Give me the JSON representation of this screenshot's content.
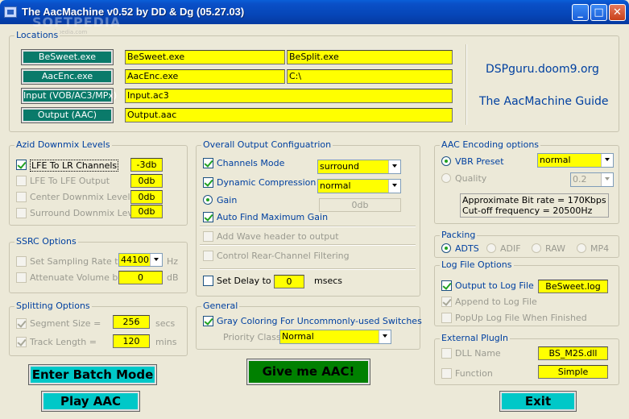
{
  "window": {
    "title": "The AacMachine v0.52 by DD & Dg (05.27.03)",
    "watermark": "SOFTPEDIA",
    "watermark_url": "www.softpedia.com"
  },
  "locations": {
    "label": "Locations",
    "besweet_btn": "BeSweet.exe",
    "aacenc_btn": "AacEnc.exe",
    "input_btn": "Input (VOB/AC3/MPx)",
    "output_btn": "Output (AAC)",
    "besweet_value": "BeSweet.exe",
    "besplit_value": "BeSplit.exe",
    "aacenc_value": "AacEnc.exe",
    "aacenc_path": "C:\\",
    "input_value": "Input.ac3",
    "output_value": "Output.aac",
    "site_link": "DSPguru.doom9.org",
    "guide_link": "The AacMachine Guide"
  },
  "downmix": {
    "label": "Azid Downmix Levels",
    "lfe_lr": "LFE To LR Channels",
    "lfe_lr_value": "-3db",
    "lfe_out": "LFE To LFE Output",
    "lfe_out_value": "0db",
    "center": "Center Downmix Level",
    "center_value": "0db",
    "surround": "Surround Downmix Level",
    "surround_value": "0db"
  },
  "ssrc": {
    "label": "SSRC Options",
    "rate_label": "Set Sampling Rate to",
    "rate_value": "44100",
    "rate_unit": "Hz",
    "atten_label": "Attenuate Volume by",
    "atten_value": "0",
    "atten_unit": "dB"
  },
  "splitting": {
    "label": "Splitting Options",
    "seg_label": "Segment Size =",
    "seg_value": "256",
    "seg_unit": "secs",
    "track_label": "Track Length  =",
    "track_value": "120",
    "track_unit": "mins"
  },
  "overall": {
    "label": "Overall Output Configuatrion",
    "channels_mode": "Channels Mode",
    "channels_value": "surround",
    "dyn_comp": "Dynamic Compression",
    "dyn_value": "normal",
    "gain": "Gain",
    "gain_value": "0db",
    "auto_find": "Auto Find Maximum Gain",
    "wave_header": "Add Wave header to output",
    "rear_filter": "Control Rear-Channel Filtering",
    "delay": "Set Delay to",
    "delay_value": "0",
    "delay_unit": "msecs"
  },
  "general": {
    "label": "General",
    "gray_coloring": "Gray Coloring For Uncommonly-used Switches",
    "priority_label": "Priority Class",
    "priority_value": "Normal"
  },
  "aac": {
    "label": "AAC Encoding options",
    "vbr": "VBR Preset",
    "vbr_value": "normal",
    "quality": "Quality",
    "quality_value": "0.2",
    "bitrate_info": "Approximate Bit rate = 170Kbps",
    "cutoff_info": "Cut-off frequency    = 20500Hz"
  },
  "packing": {
    "label": "Packing",
    "adts": "ADTS",
    "adif": "ADIF",
    "raw": "RAW",
    "mp4": "MP4"
  },
  "logfile": {
    "label": "Log File Options",
    "output_to": "Output to Log File",
    "log_value": "BeSweet.log",
    "append": "Append to Log File",
    "popup": "PopUp Log File When Finished"
  },
  "plugin": {
    "label": "External PlugIn",
    "dll": "DLL Name",
    "dll_value": "BS_M2S.dll",
    "function": "Function",
    "function_value": "Simple"
  },
  "buttons": {
    "batch": "Enter Batch Mode",
    "play": "Play AAC",
    "give": "Give me AAC!",
    "exit": "Exit"
  },
  "colors": {
    "title_bar": "#0a50c8",
    "teal": "#0a7a6a",
    "field_yellow": "#ffff00",
    "label_blue": "#0040a0",
    "cyan_button": "#00c8c8",
    "green_button": "#008000"
  }
}
